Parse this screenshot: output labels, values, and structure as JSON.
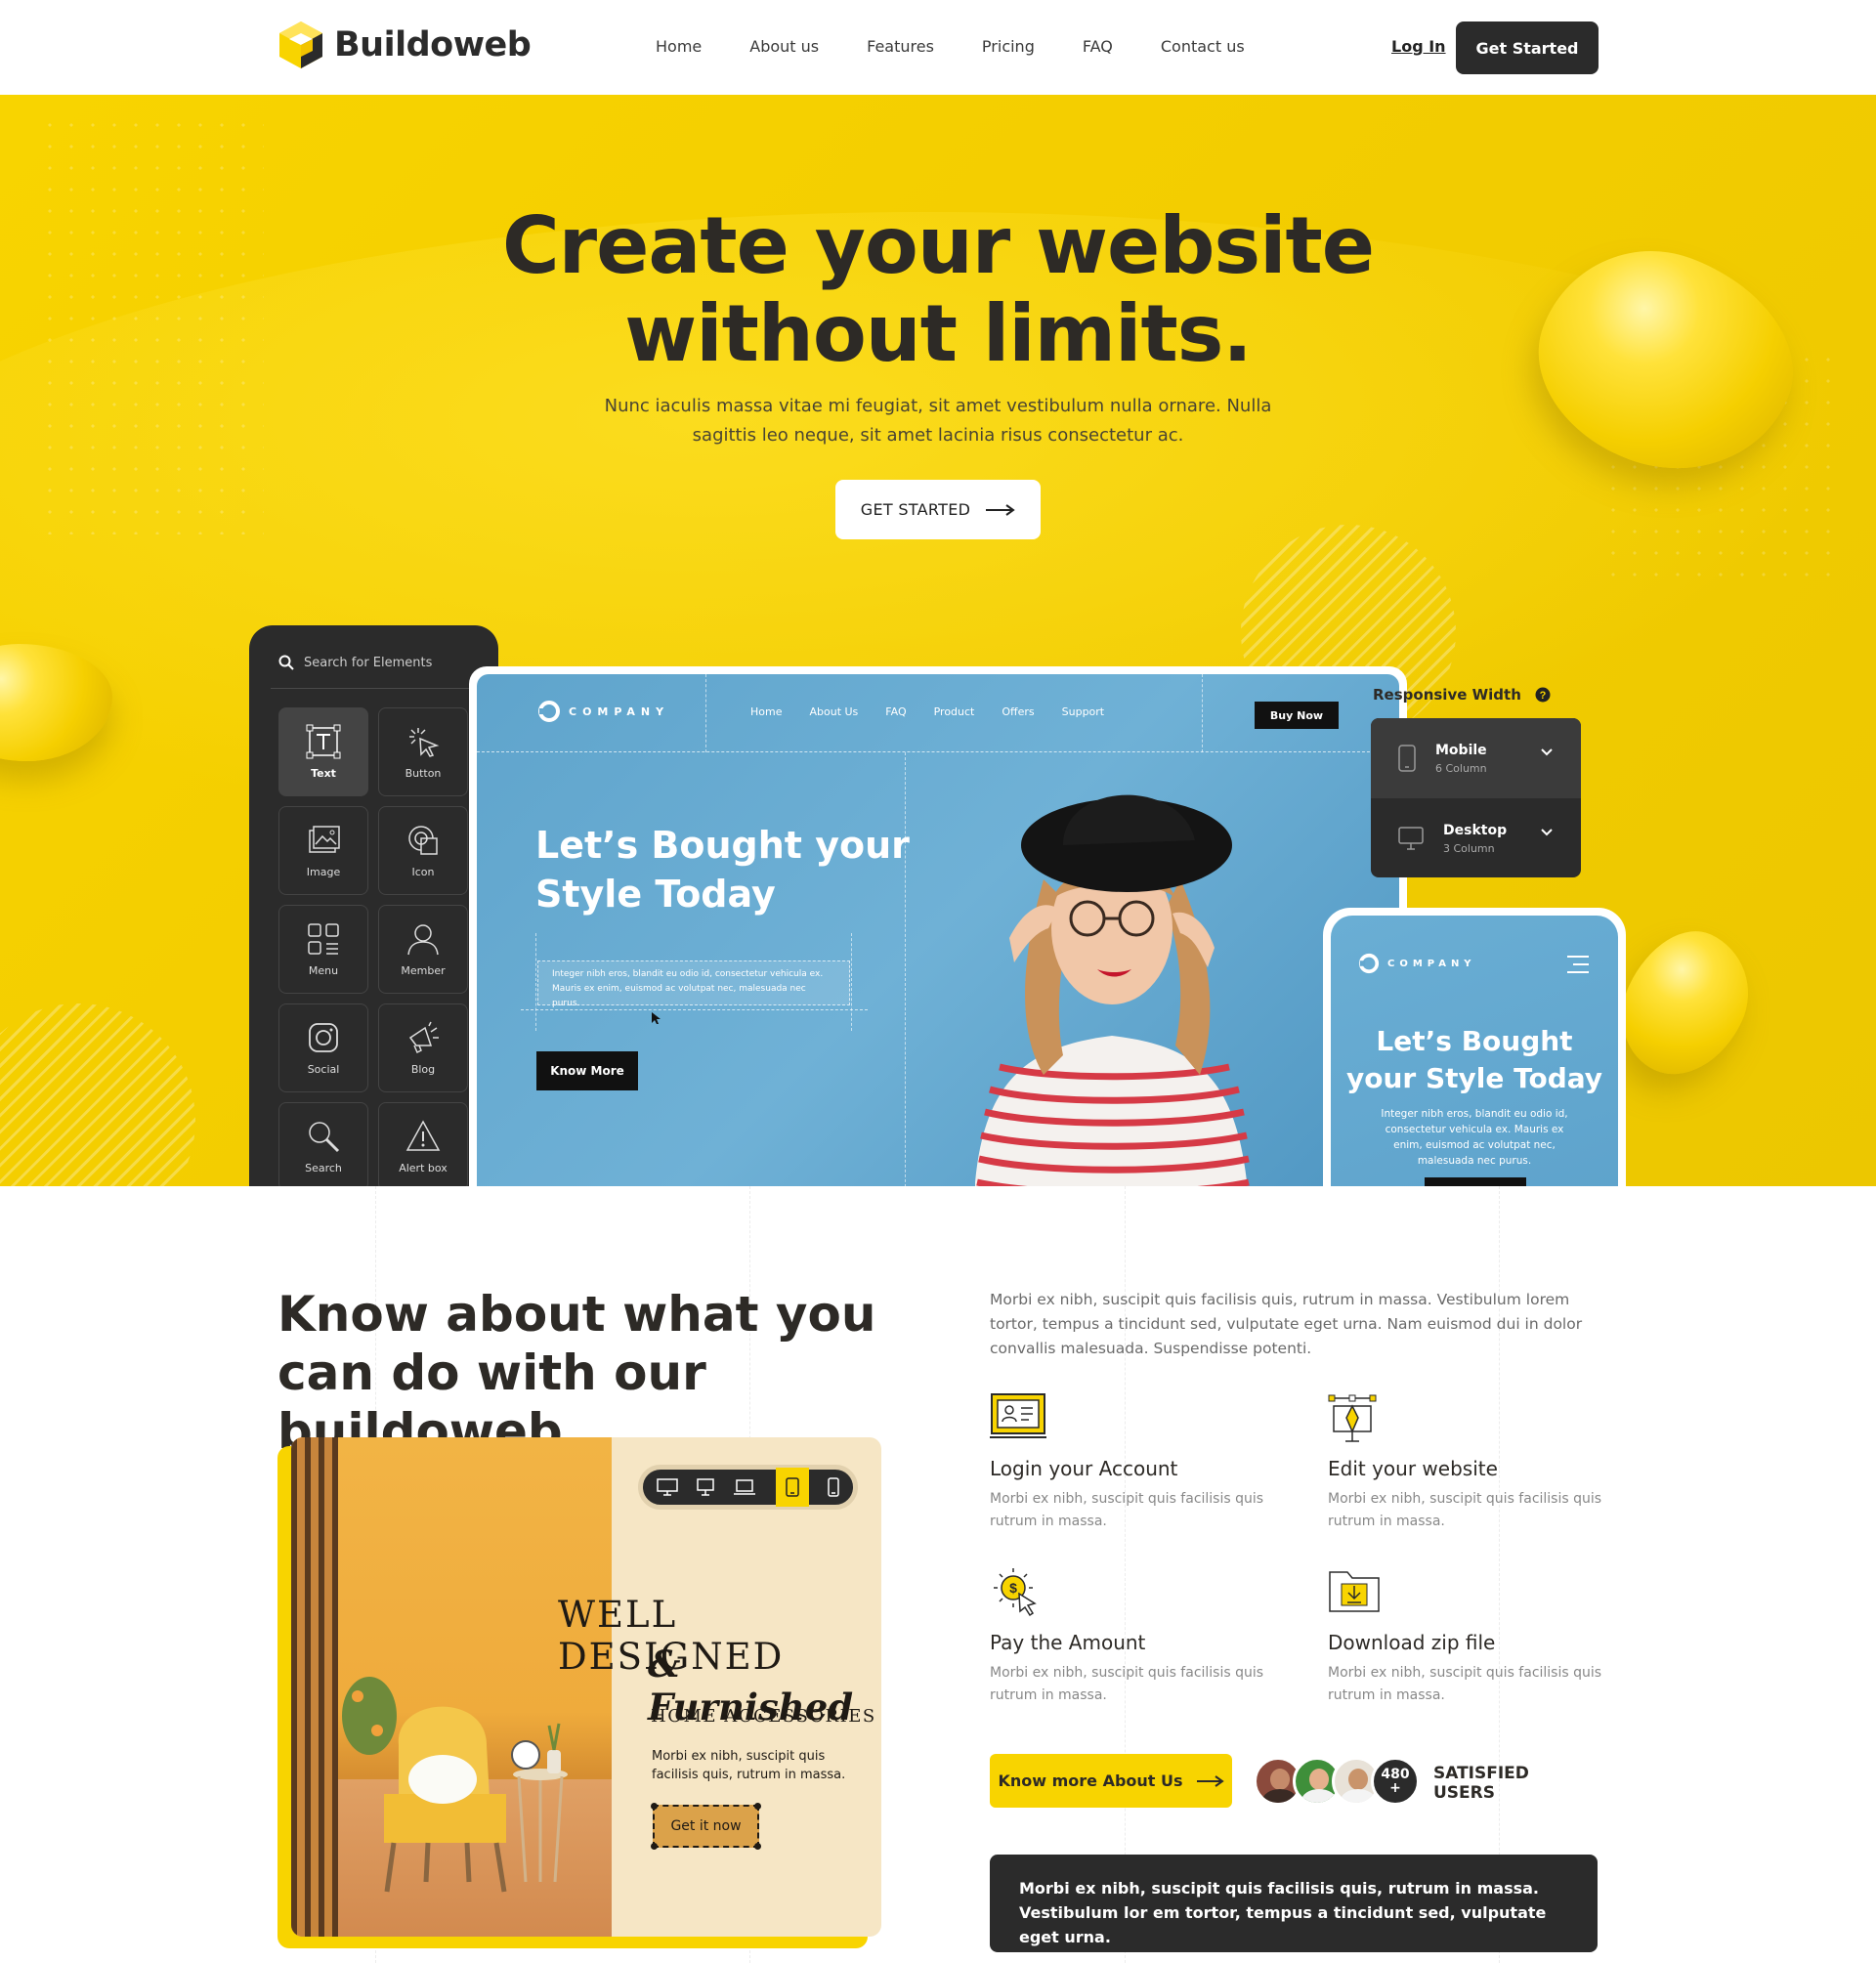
{
  "header": {
    "brand": "Buildoweb",
    "nav": [
      "Home",
      "About us",
      "Features",
      "Pricing",
      "FAQ",
      "Contact us"
    ],
    "login": "Log In",
    "cta": "Get Started"
  },
  "hero": {
    "title_line1_a": "Create your ",
    "title_line1_b": "website",
    "title_line2": "without limits.",
    "subtitle": "Nunc iaculis massa vitae mi feugiat, sit amet vestibulum nulla ornare. Nulla sagittis leo neque, sit amet lacinia risus consectetur ac.",
    "cta": "GET STARTED"
  },
  "builder": {
    "search_placeholder": "Search for Elements",
    "elements": [
      {
        "label": "Text",
        "icon": "text-icon"
      },
      {
        "label": "Button",
        "icon": "cursor-click-icon"
      },
      {
        "label": "Image",
        "icon": "image-icon"
      },
      {
        "label": "Icon",
        "icon": "shapes-icon"
      },
      {
        "label": "Menu",
        "icon": "menu-grid-icon"
      },
      {
        "label": "Member",
        "icon": "user-icon"
      },
      {
        "label": "Social",
        "icon": "instagram-icon"
      },
      {
        "label": "Blog",
        "icon": "megaphone-icon"
      },
      {
        "label": "Search",
        "icon": "search-icon"
      },
      {
        "label": "Alert box",
        "icon": "warning-icon"
      }
    ],
    "active_element": "Text",
    "responsive_label": "Responsive Width",
    "responsive_options": [
      {
        "name": "Mobile",
        "detail": "6 Column",
        "icon": "phone-icon"
      },
      {
        "name": "Desktop",
        "detail": "3 Column",
        "icon": "monitor-icon"
      }
    ]
  },
  "preview": {
    "company": "COMPANY",
    "nav": [
      "Home",
      "About Us",
      "FAQ",
      "Product",
      "Offers",
      "Support"
    ],
    "buy_now": "Buy Now",
    "headline_1": "Let’s Bought your",
    "headline_2": "Style Today",
    "body": "Integer nibh eros, blandit eu odio id, consectetur vehicula ex. Mauris ex enim, euismod ac volutpat nec, malesuada nec purus.",
    "cta": "Know More",
    "mobile_headline_1": "Let’s Bought",
    "mobile_headline_2": "your Style Today",
    "mobile_body": "Integer nibh eros, blandit eu odio id, consectetur vehicula ex. Mauris ex enim, euismod ac volutpat nec, malesuada nec purus."
  },
  "about": {
    "title_a": "Know about what you can do with our ",
    "title_b": "buildoweb",
    "text": "Morbi ex nibh, suscipit quis facilisis quis, rutrum in massa. Vestibulum lorem tortor, tempus a tincidunt sed, vulputate eget urna. Nam euismod dui in dolor convallis malesuada. Suspendisse potenti.",
    "features": [
      {
        "title": "Login your Account",
        "desc": "Morbi ex nibh, suscipit quis facilisis quis rutrum in massa.",
        "icon": "login-profile-icon"
      },
      {
        "title": "Edit your website",
        "desc": "Morbi ex nibh, suscipit quis facilisis quis rutrum in massa.",
        "icon": "pen-tool-icon"
      },
      {
        "title": "Pay the Amount",
        "desc": "Morbi ex nibh, suscipit quis facilisis quis rutrum in massa.",
        "icon": "pay-click-icon"
      },
      {
        "title": "Download zip file",
        "desc": "Morbi ex nibh, suscipit quis facilisis quis rutrum in massa.",
        "icon": "download-folder-icon"
      }
    ],
    "cta": "Know more About Us",
    "users_count": "480",
    "users_plus": "+",
    "users_label_1": "SATISFIED",
    "users_label_2": "USERS",
    "quote": "Morbi ex nibh, suscipit quis facilisis quis, rutrum in massa. Vestibulum lor em tortor, tempus a tincidunt sed, vulputate eget urna."
  },
  "promo": {
    "line1": "WELL DESIGNED",
    "line2": "& Furnished",
    "line3": "HOME ACCESSORIES",
    "text": "Morbi ex nibh, suscipit quis facilisis quis, rutrum in massa.",
    "cta": "Get it now",
    "devices": [
      "desktop-icon",
      "monitor-icon",
      "laptop-icon",
      "tablet-icon",
      "phone-icon"
    ],
    "selected_device": "tablet-icon"
  },
  "colors": {
    "accent": "#f8d400",
    "dark": "#2b2b2b",
    "preview_blue": "#62a7cf"
  }
}
